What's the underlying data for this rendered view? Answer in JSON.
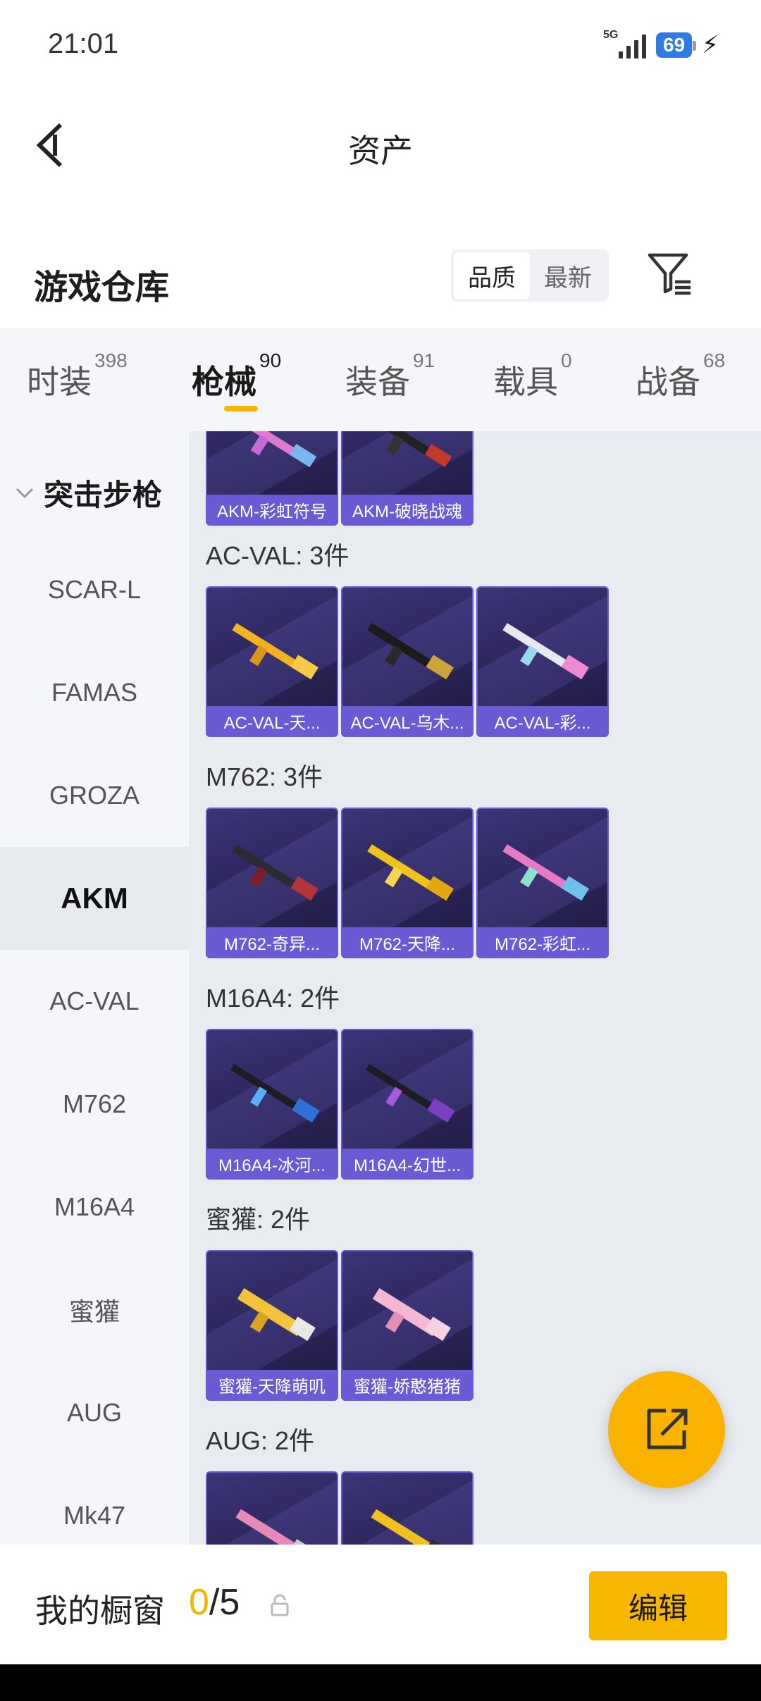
{
  "status": {
    "time": "21:01",
    "network": "5G",
    "battery": "69"
  },
  "header": {
    "title": "资产"
  },
  "warehouse": {
    "title": "游戏仓库",
    "sort_options": [
      "品质",
      "最新"
    ],
    "sort_active": "品质"
  },
  "tabs": [
    {
      "label": "时装",
      "count": "398"
    },
    {
      "label": "枪械",
      "count": "90",
      "active": true
    },
    {
      "label": "装备",
      "count": "91"
    },
    {
      "label": "载具",
      "count": "0"
    },
    {
      "label": "战备",
      "count": "68"
    }
  ],
  "sidebar": {
    "group": "突击步枪",
    "items": [
      "SCAR-L",
      "FAMAS",
      "GROZA",
      "AKM",
      "AC-VAL",
      "M762",
      "M16A4",
      "蜜獾",
      "AUG",
      "Mk47"
    ],
    "active": "AKM"
  },
  "groups": [
    {
      "title": "",
      "items": [
        "AKM-彩虹符号",
        "AKM-破晓战魂"
      ]
    },
    {
      "title": "AC-VAL: 3件",
      "items": [
        "AC-VAL-天...",
        "AC-VAL-乌木...",
        "AC-VAL-彩..."
      ]
    },
    {
      "title": "M762: 3件",
      "items": [
        "M762-奇异...",
        "M762-天降...",
        "M762-彩虹..."
      ]
    },
    {
      "title": "M16A4: 2件",
      "items": [
        "M16A4-冰河...",
        "M16A4-幻世..."
      ]
    },
    {
      "title": "蜜獾: 2件",
      "items": [
        "蜜獾-天降萌叽",
        "蜜獾-娇憨猪猪"
      ]
    },
    {
      "title": "AUG: 2件",
      "items": [
        "",
        ""
      ]
    }
  ],
  "bottom": {
    "showcase_label": "我的橱窗",
    "showcase_used": "0",
    "showcase_total": "/5",
    "edit_label": "编辑"
  },
  "colors": {
    "accent": "#f7b600",
    "card_bg": "#2a2456",
    "card_caption": "#6a5bd4"
  },
  "icons": {
    "back": "back-arrow-icon",
    "filter": "filter-icon",
    "share": "share-icon",
    "lock": "lock-icon"
  }
}
